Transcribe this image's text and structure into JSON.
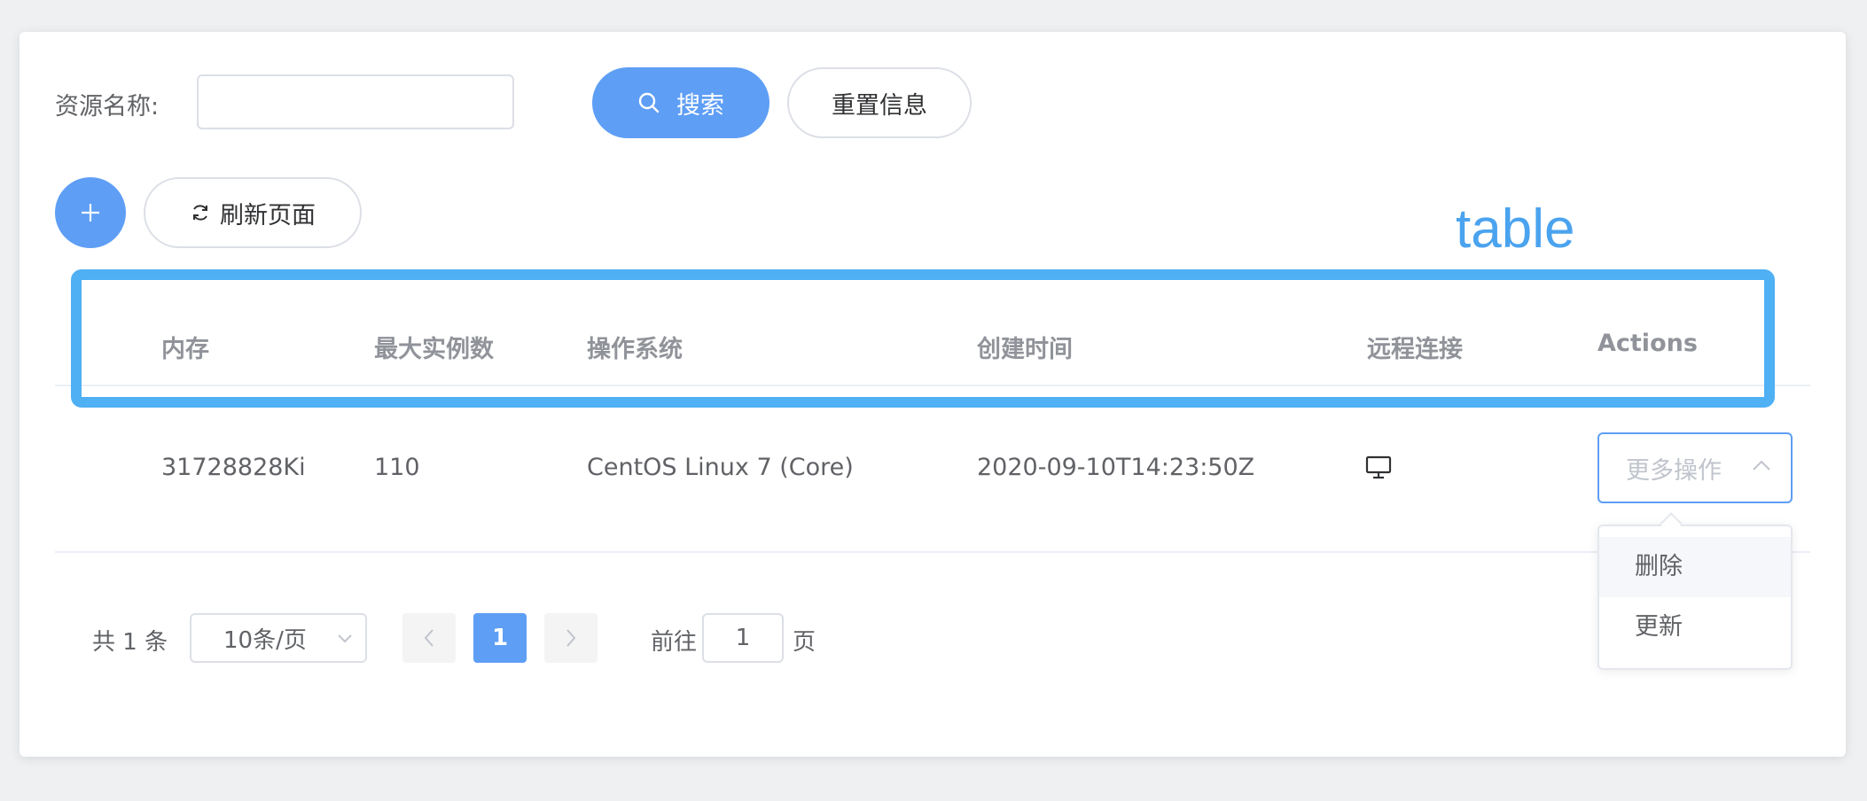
{
  "search": {
    "label": "资源名称:",
    "input_value": "",
    "search_button": "搜索",
    "reset_button": "重置信息"
  },
  "toolbar": {
    "refresh_button": "刷新页面"
  },
  "annotation": {
    "label": "table",
    "color": "#4fb0f3"
  },
  "table": {
    "columns": [
      "内存",
      "最大实例数",
      "操作系统",
      "创建时间",
      "远程连接",
      "Actions"
    ],
    "rows": [
      {
        "memory": "31728828Ki",
        "max_instances": "110",
        "os": "CentOS Linux 7 (Core)",
        "created_at": "2020-09-10T14:23:50Z",
        "remote_icon": "monitor-icon",
        "actions_placeholder": "更多操作"
      }
    ]
  },
  "dropdown": {
    "items": [
      "删除",
      "更新"
    ]
  },
  "pagination": {
    "total": "共 1 条",
    "page_size": "10条/页",
    "current_page": "1",
    "goto_label": "前往",
    "goto_value": "1",
    "goto_suffix": "页"
  },
  "colors": {
    "primary": "#5e9ef5",
    "annotation": "#4fb0f3"
  }
}
